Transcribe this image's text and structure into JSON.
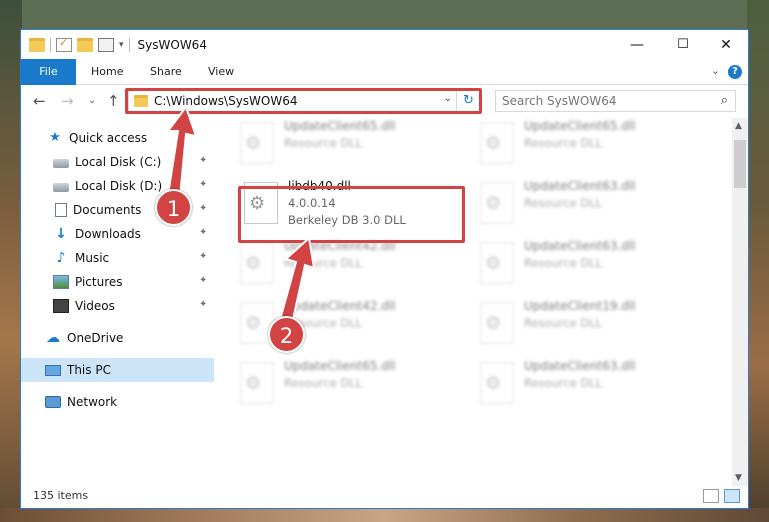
{
  "window": {
    "title": "SysWOW64",
    "minimize_glyph": "—",
    "maximize_glyph": "☐",
    "close_glyph": "✕"
  },
  "ribbon": {
    "tabs": [
      "File",
      "Home",
      "Share",
      "View"
    ],
    "help_glyph": "?",
    "collapse_glyph": "⌄"
  },
  "nav": {
    "back_glyph": "←",
    "forward_glyph": "→",
    "recent_glyph": "⌄",
    "up_glyph": "↑",
    "address_path": "C:\\Windows\\SysWOW64",
    "address_dropdown_glyph": "⌄",
    "refresh_glyph": "↻",
    "search_placeholder": "Search SysWOW64",
    "search_icon": "magnifier-icon"
  },
  "sidebar": {
    "items": [
      {
        "label": "Quick access",
        "icon": "star-icon",
        "pinned": false
      },
      {
        "label": "Local Disk (C:)",
        "icon": "disk-icon",
        "pinned": true
      },
      {
        "label": "Local Disk (D:)",
        "icon": "disk-icon",
        "pinned": true
      },
      {
        "label": "Documents",
        "icon": "documents-icon",
        "pinned": true
      },
      {
        "label": "Downloads",
        "icon": "downloads-icon",
        "pinned": true
      },
      {
        "label": "Music",
        "icon": "music-icon",
        "pinned": true
      },
      {
        "label": "Pictures",
        "icon": "pictures-icon",
        "pinned": true
      },
      {
        "label": "Videos",
        "icon": "videos-icon",
        "pinned": true
      },
      {
        "label": "OneDrive",
        "icon": "cloud-icon",
        "pinned": false
      },
      {
        "label": "This PC",
        "icon": "pc-icon",
        "pinned": false,
        "selected": true
      },
      {
        "label": "Network",
        "icon": "network-icon",
        "pinned": false
      }
    ],
    "pin_glyph": "📌"
  },
  "files": [
    {
      "name": "UpdateClient65.dll",
      "desc": "Resource DLL",
      "blurred": true
    },
    {
      "name": "UpdateClient65.dll",
      "desc": "Resource DLL",
      "blurred": true
    },
    {
      "name": "libdb40.dll",
      "version": "4.0.0.14",
      "desc": "Berkeley DB 3.0 DLL",
      "blurred": false
    },
    {
      "name": "UpdateClient63.dll",
      "desc": "Resource DLL",
      "blurred": true
    },
    {
      "name": "UpdateClient42.dll",
      "desc": "Resource DLL",
      "blurred": true
    },
    {
      "name": "UpdateClient63.dll",
      "desc": "Resource DLL",
      "blurred": true
    },
    {
      "name": "UpdateClient42.dll",
      "desc": "Resource DLL",
      "blurred": true
    },
    {
      "name": "UpdateClient19.dll",
      "desc": "Resource DLL",
      "blurred": true
    },
    {
      "name": "UpdateClient65.dll",
      "desc": "Resource DLL",
      "blurred": true
    },
    {
      "name": "UpdateClient63.dll",
      "desc": "Resource DLL",
      "blurred": true
    }
  ],
  "scroll": {
    "up_glyph": "▲",
    "down_glyph": "▼"
  },
  "status": {
    "item_count": "135 items"
  },
  "annotations": {
    "step1": "1",
    "step2": "2",
    "color": "#d24343"
  }
}
